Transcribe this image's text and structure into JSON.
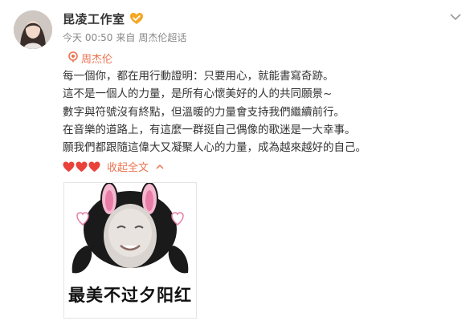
{
  "post": {
    "author": "昆凌工作室",
    "verify_icon": "verified-badge-icon",
    "time": "今天 00:50",
    "source_prefix": "来自",
    "source": "周杰伦超话",
    "topic_icon": "super-topic-icon",
    "topic": "周杰伦",
    "lines": [
      "每一個你，都在用行動證明：只要用心，就能書寫奇跡。",
      "這不是一個人的力量，是所有心懷美好的人的共同願景~",
      "數字與符號沒有終點，但溫暖的力量會支持我們繼續前行。",
      "在音樂的道路上，有這麼一群挺自己偶像的歌迷是一大幸事。",
      "願我們都跟隨這偉大又凝聚人心的力量，成為越來越好的自己。"
    ],
    "collapse_label": "收起全文",
    "more_icon": "chevron-down-icon",
    "collapse_icon": "chevron-up-icon"
  },
  "sticker": {
    "caption": "最美不过夕阳红"
  },
  "colors": {
    "accent": "#eb7350",
    "heart": "#e8423a",
    "text": "#333333",
    "meta": "#888888"
  }
}
